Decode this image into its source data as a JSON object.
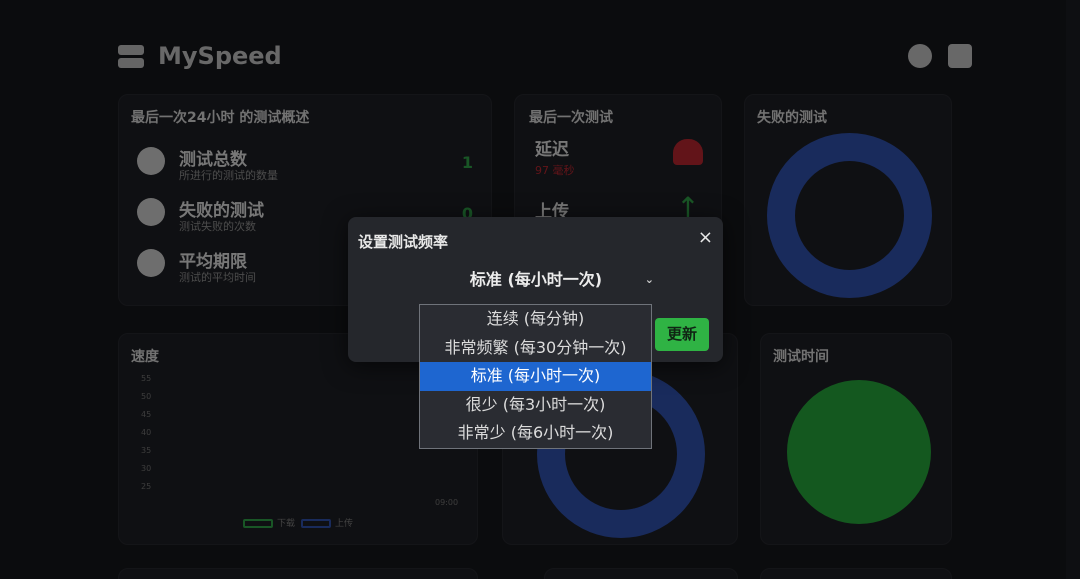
{
  "app": {
    "name": "MySpeed"
  },
  "header": {
    "icons": [
      "speedometer-icon",
      "gear-icon"
    ]
  },
  "summary_card": {
    "title": "最后一次24小时 的测试概述",
    "stats": [
      {
        "icon": "gauge-icon",
        "title": "测试总数",
        "subtitle": "所进行的测试的数量",
        "value": "1"
      },
      {
        "icon": "alert-icon",
        "title": "失败的测试",
        "subtitle": "测试失败的次数",
        "value": "0"
      },
      {
        "icon": "stopwatch-icon",
        "title": "平均期限",
        "subtitle": "测试的平均时间",
        "value": ""
      }
    ]
  },
  "latest_card": {
    "title": "最后一次测试",
    "rows": [
      {
        "title": "延迟",
        "subtitle": "97 毫秒",
        "icon": "ping-icon"
      },
      {
        "title": "上传",
        "subtitle": "",
        "icon": "arrow-up-icon"
      }
    ]
  },
  "failed_card": {
    "title": "失败的测试"
  },
  "speed_card": {
    "title": "速度",
    "y_ticks": [
      "55",
      "50",
      "45",
      "40",
      "35",
      "30",
      "25"
    ],
    "x_tick": "09:00",
    "legend": [
      "下载",
      "上传"
    ]
  },
  "time_card": {
    "title": "测试时间"
  },
  "modal": {
    "title": "设置测试频率",
    "close": "×",
    "selected_value": "标准 (每小时一次)",
    "update_label": "更新",
    "options": [
      "连续 (每分钟)",
      "非常频繁 (每30分钟一次)",
      "标准 (每小时一次)",
      "很少 (每3小时一次)",
      "非常少 (每6小时一次)"
    ],
    "selected_index": 2
  },
  "colors": {
    "accent_green": "#2fb344",
    "selection_blue": "#1e66d0",
    "ring_blue": "#2e4fa8",
    "disc_green": "#25a03a",
    "error_red": "#b2252e"
  }
}
